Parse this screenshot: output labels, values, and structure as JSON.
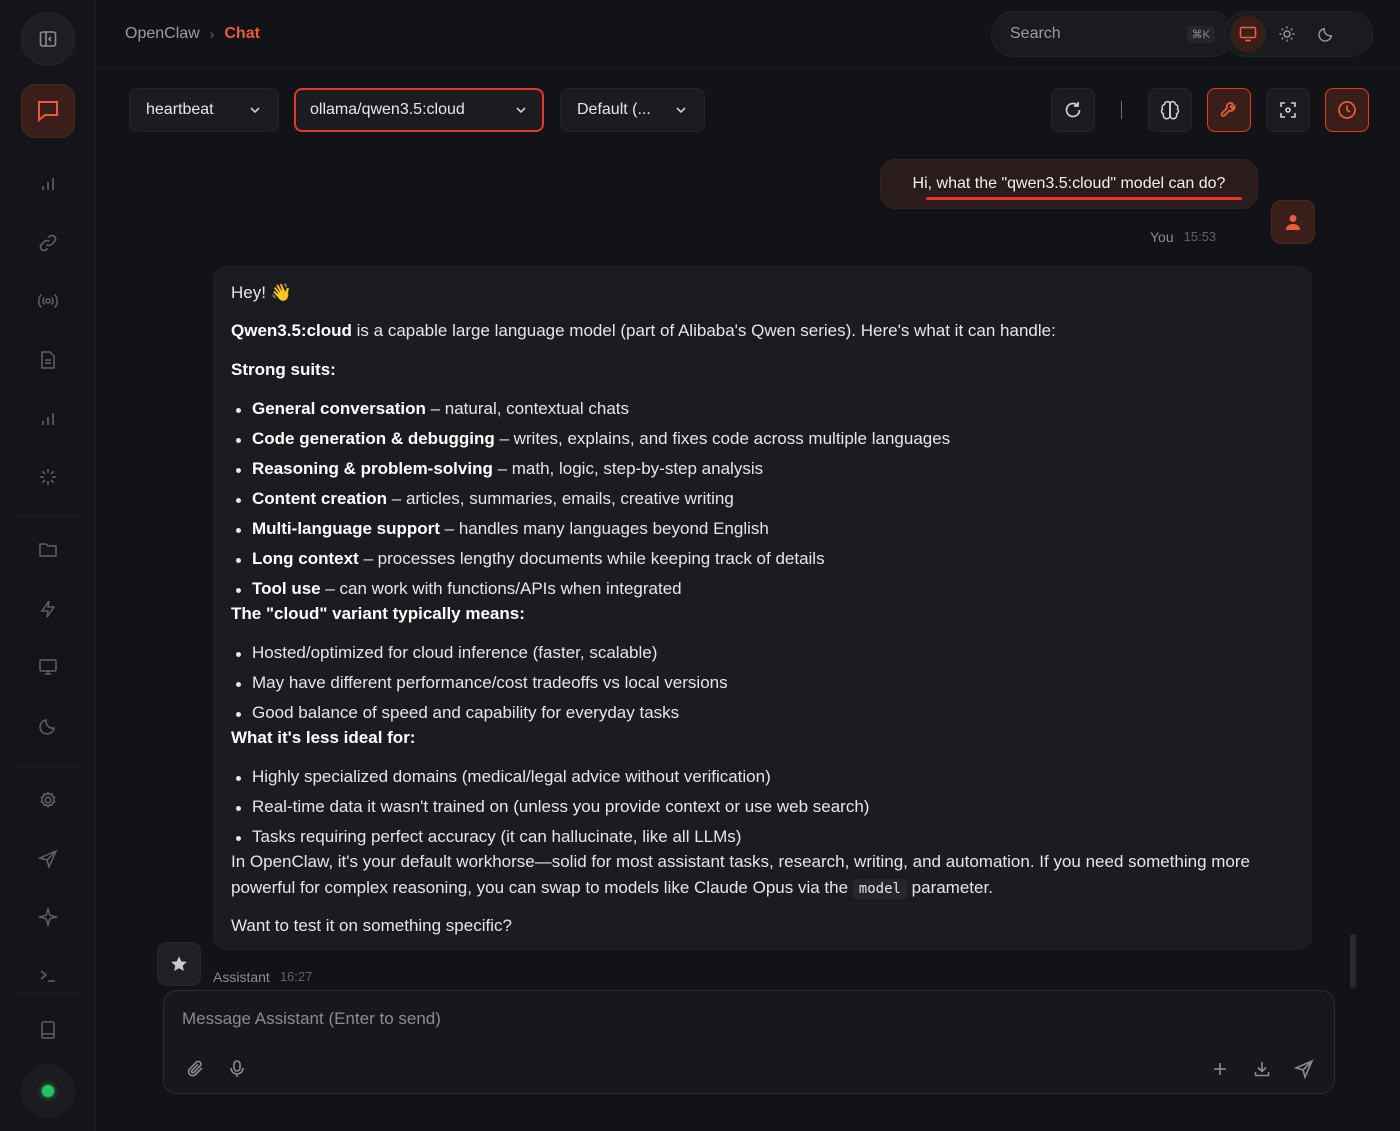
{
  "breadcrumb": {
    "root": "OpenClaw",
    "separator": "›",
    "current": "Chat"
  },
  "search": {
    "placeholder": "Search",
    "shortcut": "⌘K"
  },
  "theme": {
    "options": [
      "system",
      "light",
      "dark"
    ],
    "active": "system"
  },
  "toolbar": {
    "agent": "heartbeat",
    "model": "ollama/qwen3.5:cloud",
    "mode": "Default (...",
    "buttons": [
      "refresh-icon",
      "brain-icon",
      "wrench-icon",
      "focus-icon",
      "clock-icon"
    ]
  },
  "user_message": {
    "text": "Hi, what the \"qwen3.5:cloud\" model can do?",
    "author": "You",
    "time": "15:53"
  },
  "assistant_message": {
    "greeting": "Hey! 👋",
    "intro_bold": "Qwen3.5:cloud",
    "intro_rest": " is a capable large language model (part of Alibaba's Qwen series). Here's what it can handle:",
    "strong_heading": "Strong suits:",
    "strong_items": [
      {
        "bold": "General conversation",
        "text": " – natural, contextual chats"
      },
      {
        "bold": "Code generation & debugging",
        "text": " – writes, explains, and fixes code across multiple languages"
      },
      {
        "bold": "Reasoning & problem-solving",
        "text": " – math, logic, step-by-step analysis"
      },
      {
        "bold": "Content creation",
        "text": " – articles, summaries, emails, creative writing"
      },
      {
        "bold": "Multi-language support",
        "text": " – handles many languages beyond English"
      },
      {
        "bold": "Long context",
        "text": " – processes lengthy documents while keeping track of details"
      },
      {
        "bold": "Tool use",
        "text": " – can work with functions/APIs when integrated"
      }
    ],
    "cloud_heading": "The \"cloud\" variant typically means:",
    "cloud_items": [
      "Hosted/optimized for cloud inference (faster, scalable)",
      "May have different performance/cost tradeoffs vs local versions",
      "Good balance of speed and capability for everyday tasks"
    ],
    "less_heading": "What it's less ideal for:",
    "less_items": [
      "Highly specialized domains (medical/legal advice without verification)",
      "Real-time data it wasn't trained on (unless you provide context or use web search)",
      "Tasks requiring perfect accuracy (it can hallucinate, like all LLMs)"
    ],
    "closing_line1": "In OpenClaw, it's your default workhorse—solid for most assistant tasks, research, writing, and automation. If you need something more",
    "closing_line2_before": "powerful for complex reasoning, you can swap to models like Claude Opus via the ",
    "closing_code": "model",
    "closing_line2_after": " parameter.",
    "question": "Want to test it on something specific?",
    "author": "Assistant",
    "time": "16:27"
  },
  "composer": {
    "placeholder": "Message Assistant (Enter to send)"
  },
  "colors": {
    "accent": "#ef5a3c",
    "highlight_border": "#e8362a",
    "online": "#22c55e",
    "background": "#121316"
  }
}
